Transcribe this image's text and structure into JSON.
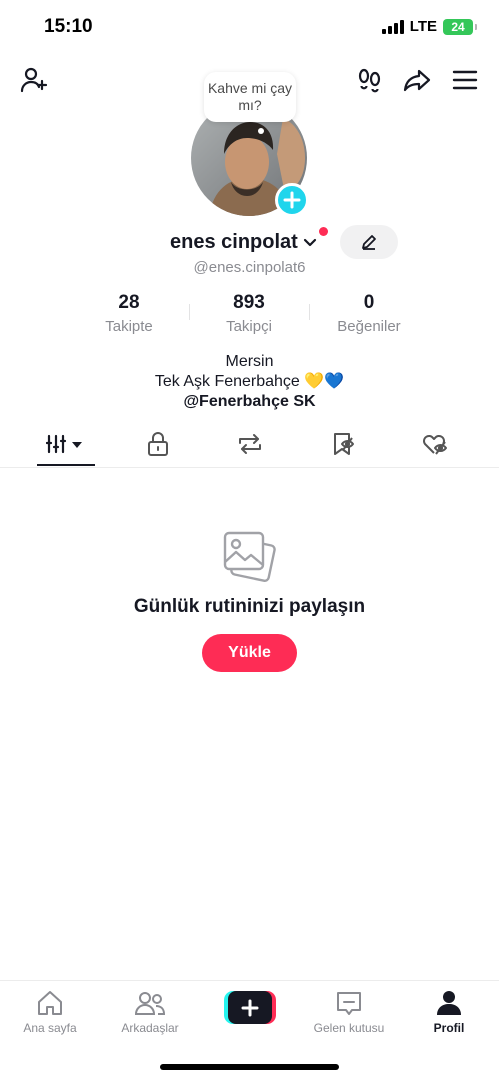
{
  "status_bar": {
    "time": "15:10",
    "network": "LTE",
    "battery": "24"
  },
  "profile": {
    "bubble_text": "Kahve mi çay mı?",
    "username": "enes cinpolat",
    "handle": "@enes.cinpolat6"
  },
  "stats": [
    {
      "value": "28",
      "label": "Takipte"
    },
    {
      "value": "893",
      "label": "Takipçi"
    },
    {
      "value": "0",
      "label": "Beğeniler"
    }
  ],
  "bio": {
    "line1": "Mersin",
    "line2": "Tek Aşk Fenerbahçe 💛💙",
    "link": "@Fenerbahçe SK"
  },
  "tabs": [
    {
      "icon": "videos-grid-icon",
      "active": true
    },
    {
      "icon": "lock-icon"
    },
    {
      "icon": "repost-icon"
    },
    {
      "icon": "favorites-icon"
    },
    {
      "icon": "liked-icon"
    }
  ],
  "empty_state": {
    "title": "Günlük rutininizi paylaşın",
    "button": "Yükle"
  },
  "bottom_nav": {
    "home": "Ana sayfa",
    "friends": "Arkadaşlar",
    "inbox": "Gelen kutusu",
    "profile": "Profil"
  },
  "colors": {
    "accent": "#fe2c55",
    "cyan": "#20d5ec",
    "text": "#161823",
    "muted": "#8a8b91"
  }
}
